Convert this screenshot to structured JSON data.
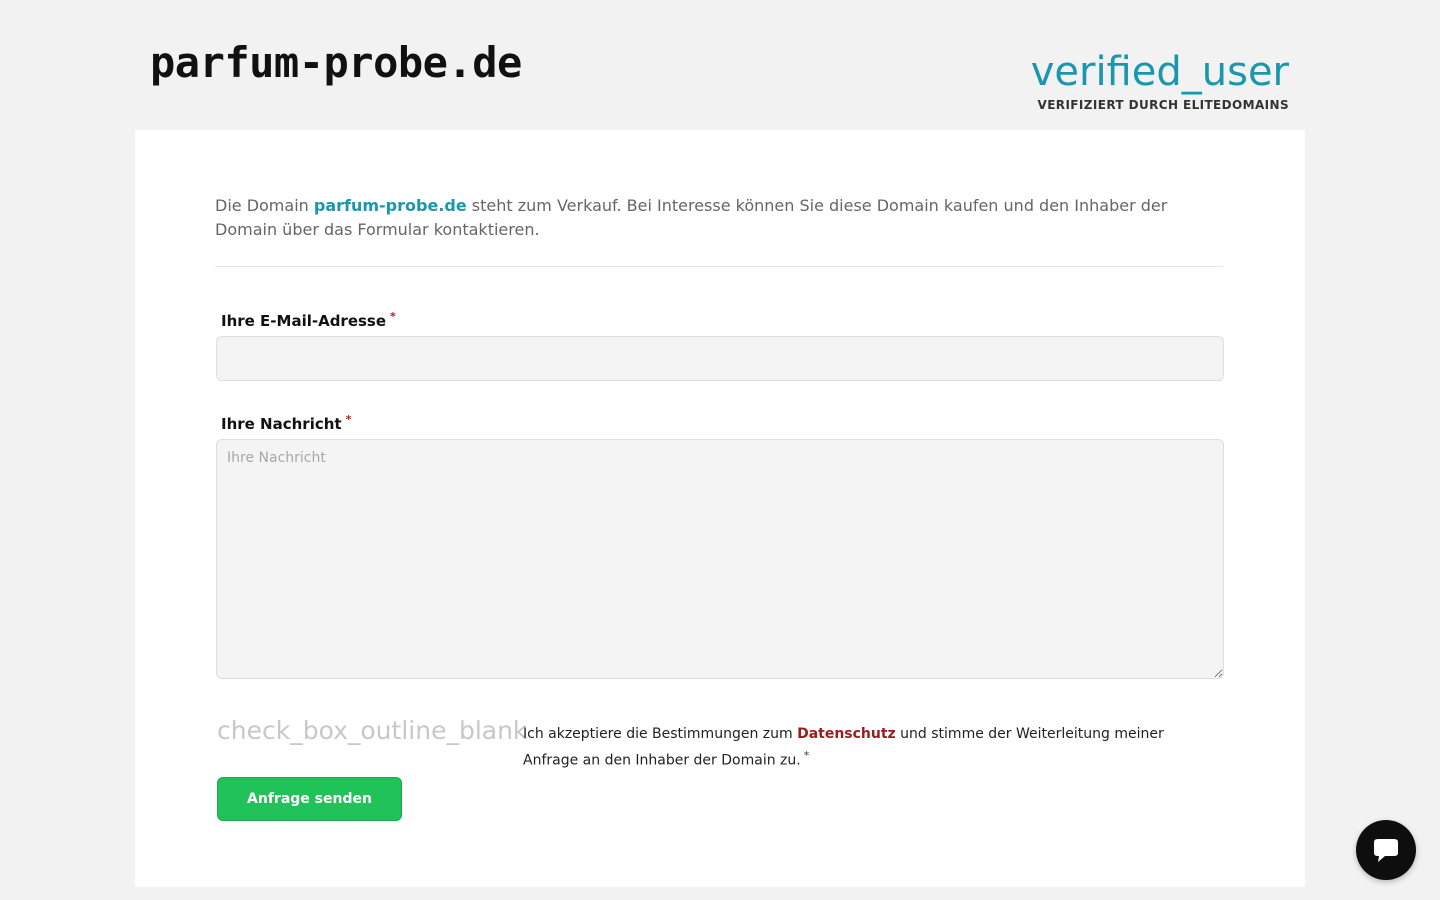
{
  "header": {
    "logo_text": "parfum-probe.de",
    "verified_icon": "verified_user",
    "verified_label": "VERIFIZIERT DURCH ELITEDOMAINS"
  },
  "intro": {
    "prefix": "Die Domain ",
    "domain": "parfum-probe.de",
    "suffix": " steht zum Verkauf. Bei Interesse können Sie diese Domain kaufen und den Inhaber der Domain über das Formular kontaktieren."
  },
  "form": {
    "email_label": "Ihre E-Mail-Adresse",
    "email_value": "",
    "email_placeholder": "",
    "message_label": "Ihre Nachricht",
    "message_placeholder": "Ihre Nachricht",
    "required_mark": "*",
    "consent_checkbox_icon": "check_box_outline_blank",
    "consent_prefix": "Ich akzeptiere die Bestimmungen zum ",
    "consent_link": "Datenschutz",
    "consent_suffix": " und stimme der Weiterleitung meiner Anfrage an den Inhaber der Domain zu.",
    "submit_label": "Anfrage senden"
  },
  "chat": {
    "icon": "chat-bubble-icon"
  },
  "colors": {
    "accent": "#1a97ad",
    "submit": "#22c25a",
    "privacy_link": "#9b1c1c",
    "background": "#f2f2f2"
  }
}
